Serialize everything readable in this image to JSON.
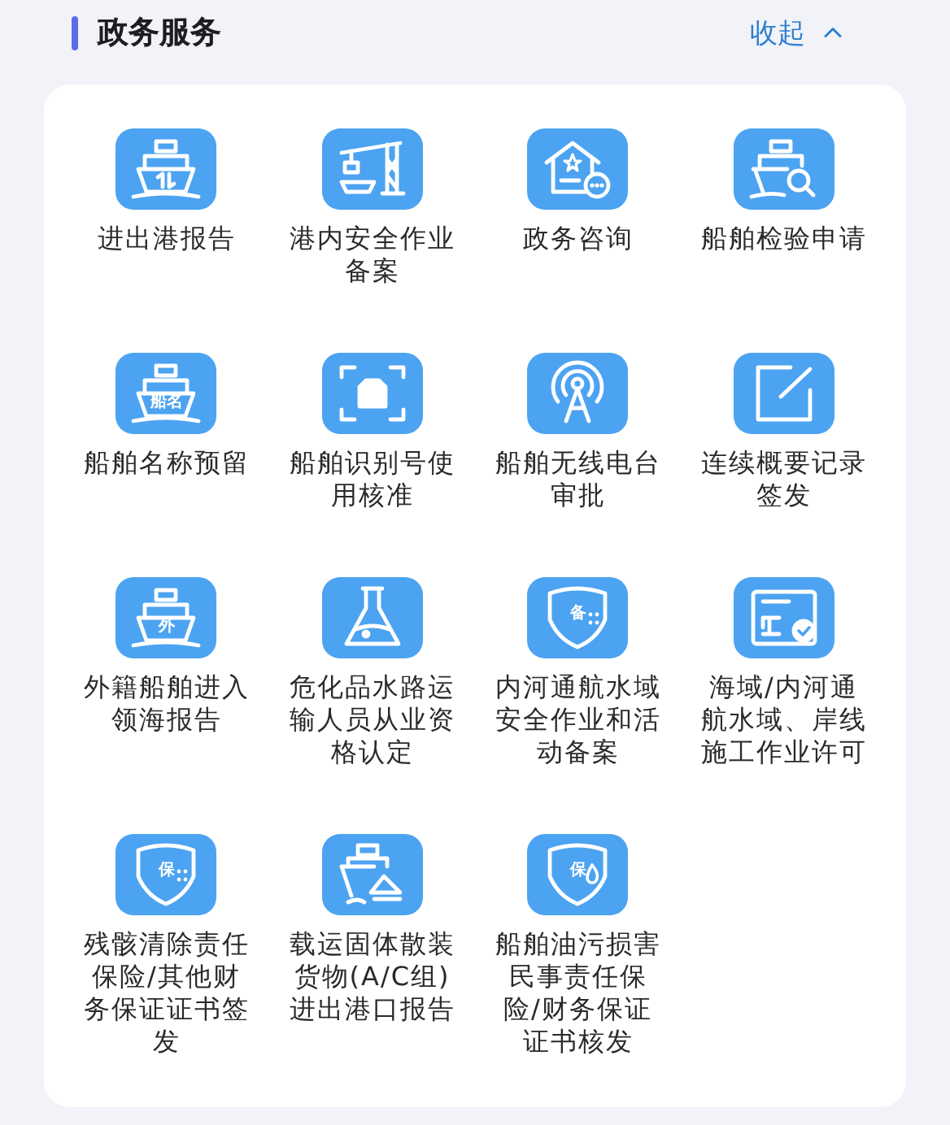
{
  "section": {
    "title": "政务服务",
    "toggle_label": "收起",
    "expanded": true
  },
  "services": [
    {
      "label": "进出港报告",
      "kind": "ship"
    },
    {
      "label": "港内安全作业备案",
      "kind": "crane"
    },
    {
      "label": "政务咨询",
      "kind": "consult"
    },
    {
      "label": "船舶检验申请",
      "kind": "search"
    },
    {
      "label": "船舶名称预留",
      "kind": "badge",
      "icon_text": "船名"
    },
    {
      "label": "船舶识别号使用核准",
      "kind": "scan"
    },
    {
      "label": "船舶无线电台审批",
      "kind": "antenna"
    },
    {
      "label": "连续概要记录签发",
      "kind": "edit"
    },
    {
      "label": "外籍船舶进入领海报告",
      "kind": "badge",
      "icon_text": "外"
    },
    {
      "label": "危化品水路运输人员从业资格认定",
      "kind": "flask"
    },
    {
      "label": "内河通航水域安全作业和活动备案",
      "kind": "shield",
      "icon_text": "备"
    },
    {
      "label": "海域/内河通航水域、岸线施工作业许可",
      "kind": "certificate"
    },
    {
      "label": "残骸清除责任保险/其他财务保证证书签发",
      "kind": "shield",
      "icon_text": "保"
    },
    {
      "label": "载运固体散装货物(A/C组)进出港口报告",
      "kind": "cargo"
    },
    {
      "label": "船舶油污损害民事责任保险/财务保证证书核发",
      "kind": "drop",
      "icon_text": "保"
    }
  ]
}
